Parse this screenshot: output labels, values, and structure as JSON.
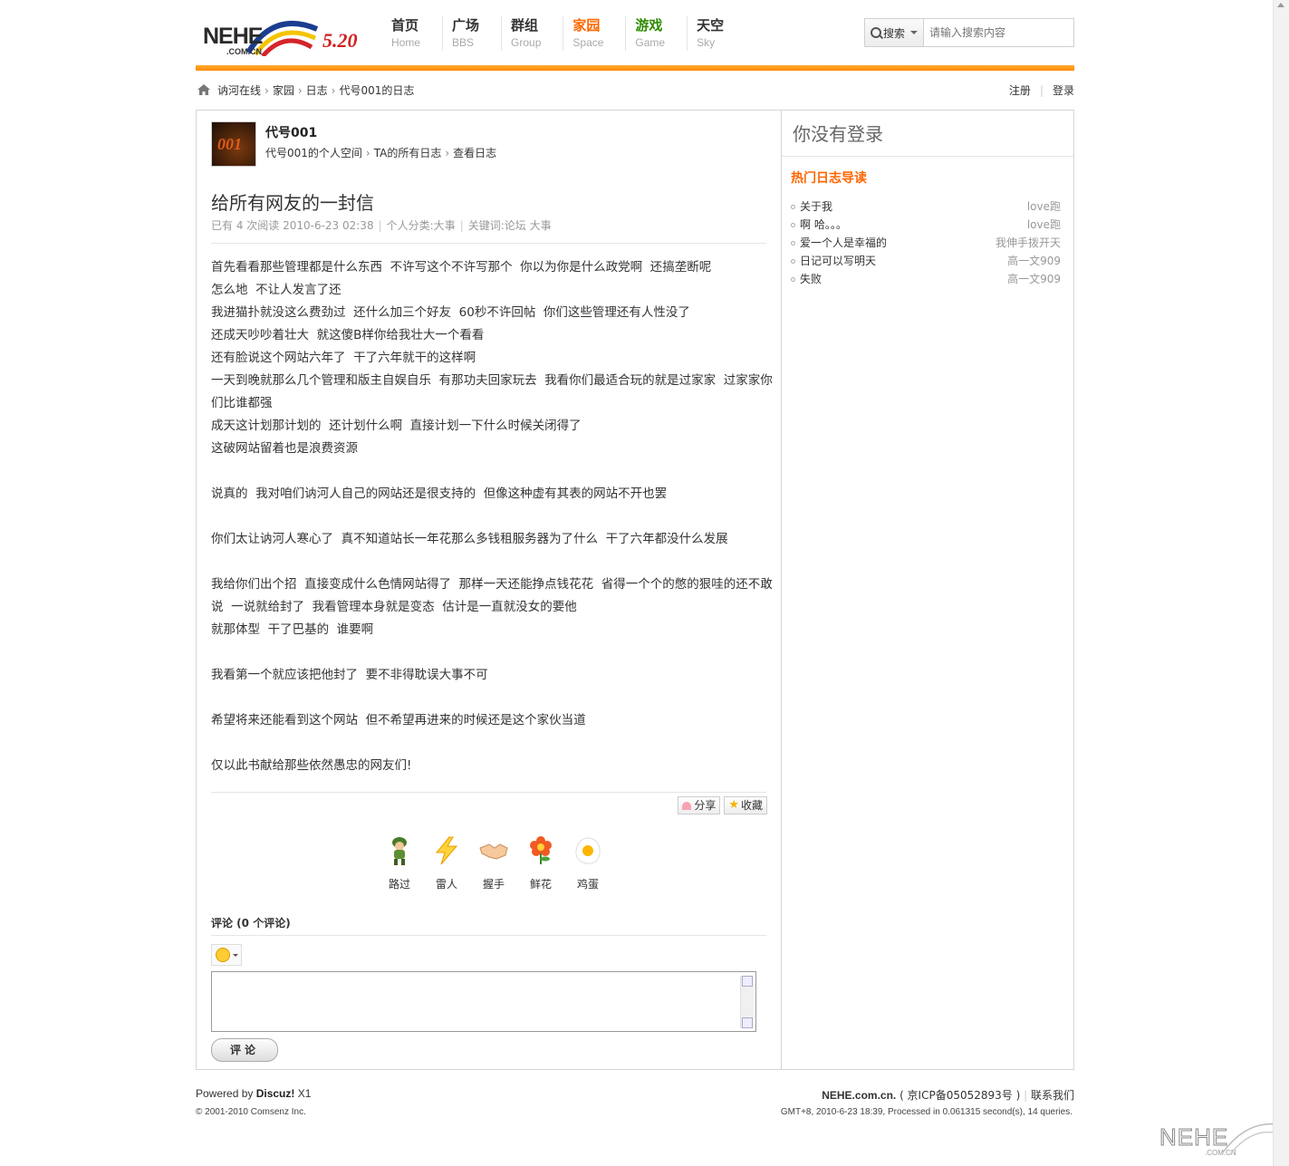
{
  "header": {
    "logo_text": "NEHE",
    "logo_sub": ".COM.CN",
    "logo_badge": "5.20",
    "nav": [
      {
        "cn": "首页",
        "en": "Home"
      },
      {
        "cn": "广场",
        "en": "BBS"
      },
      {
        "cn": "群组",
        "en": "Group"
      },
      {
        "cn": "家园",
        "en": "Space"
      },
      {
        "cn": "游戏",
        "en": "Game"
      },
      {
        "cn": "天空",
        "en": "Sky"
      }
    ],
    "search_label": "搜索",
    "search_placeholder": "请输入搜索内容",
    "accent_color": "#ff8a00"
  },
  "breadcrumb": {
    "items": [
      "讷河在线",
      "家园",
      "日志",
      "代号001的日志"
    ],
    "register": "注册",
    "login": "登录"
  },
  "user": {
    "avatar_text": "001",
    "name": "代号001",
    "links": [
      "代号001的个人空间",
      "TA的所有日志",
      "查看日志"
    ]
  },
  "post": {
    "title": "给所有网友的一封信",
    "meta_views": "已有  4 次阅读  2010-6-23 02:38",
    "meta_category": "个人分类:大事",
    "meta_keywords": "关键词:论坛  大事",
    "paragraphs": [
      "首先看看那些管理都是什么东西  不许写这个不许写那个  你以为你是什么政党啊  还搞垄断呢",
      "怎么地  不让人发言了还",
      "我进猫扑就没这么费劲过  还什么加三个好友  60秒不许回帖  你们这些管理还有人性没了",
      "还成天吵吵着壮大  就这傻B样你给我壮大一个看看",
      "还有脸说这个网站六年了  干了六年就干的这样啊",
      "一天到晚就那么几个管理和版主自娱自乐  有那功夫回家玩去  我看你们最适合玩的就是过家家  过家家你们比谁都强",
      "成天这计划那计划的  还计划什么啊  直接计划一下什么时候关闭得了",
      "这破网站留着也是浪费资源",
      "",
      "说真的  我对咱们讷河人自己的网站还是很支持的  但像这种虚有其表的网站不开也罢",
      "",
      "你们太让讷河人寒心了  真不知道站长一年花那么多钱租服务器为了什么  干了六年都没什么发展",
      "",
      "我给你们出个招  直接变成什么色情网站得了  那样一天还能挣点钱花花  省得一个个的憋的狠哇的还不敢说  一说就给封了  我看管理本身就是变态  估计是一直就没女的要他",
      "就那体型  干了巴基的  谁要啊",
      "",
      "我看第一个就应该把他封了  要不非得耽误大事不可",
      "",
      "希望将来还能看到这个网站  但不希望再进来的时候还是这个家伙当道",
      "",
      "仅以此书献给那些依然愚忠的网友们!"
    ],
    "share_label": "分享",
    "fav_label": "收藏",
    "reactions": [
      "路过",
      "雷人",
      "握手",
      "鲜花",
      "鸡蛋"
    ],
    "comment_header": "评论 (0 个评论)",
    "submit_label": "评论"
  },
  "sidebar": {
    "login_notice": "你没有登录",
    "hot_title": "热门日志导读",
    "hot_list": [
      {
        "title": "关于我",
        "author": "love跑"
      },
      {
        "title": "啊  哈。。。",
        "author": "love跑"
      },
      {
        "title": "爱一个人是幸福的",
        "author": "我伸手拨开天"
      },
      {
        "title": "日记可以写明天",
        "author": "高一文909"
      },
      {
        "title": "失败",
        "author": "高一文909"
      }
    ]
  },
  "footer": {
    "powered_prefix": "Powered by ",
    "powered_brand": "Discuz!",
    "powered_version": " X1",
    "copyright": "© 2001-2010 Comsenz Inc.",
    "site_name": "NEHE.com.cn.",
    "icp": " ( 京ICP备05052893号 ) ",
    "contact": "联系我们",
    "gmt": "GMT+8, 2010-6-23 18:39, Processed in 0.061315 second(s), 14 queries.",
    "watermark": "NEHE",
    "watermark_sub": ".COM.CN"
  }
}
